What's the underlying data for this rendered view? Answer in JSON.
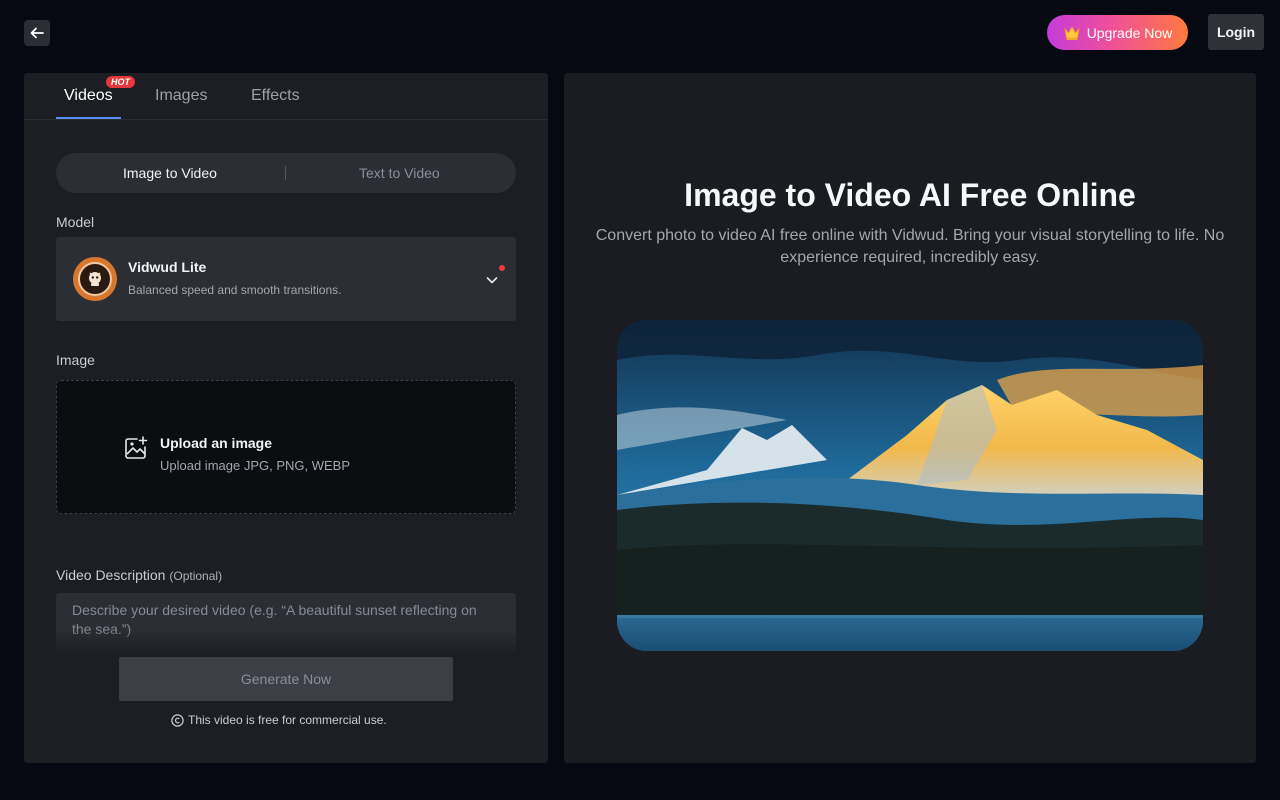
{
  "header": {
    "upgrade_label": "Upgrade Now",
    "login_label": "Login"
  },
  "tabs": [
    {
      "label": "Videos",
      "active": true,
      "badge": "HOT"
    },
    {
      "label": "Images",
      "active": false
    },
    {
      "label": "Effects",
      "active": false
    }
  ],
  "mode_switch": {
    "options": [
      "Image to Video",
      "Text to Video"
    ],
    "selected": "Image to Video"
  },
  "model": {
    "section_label": "Model",
    "name": "Vidwud Lite",
    "description": "Balanced speed and smooth transitions."
  },
  "image": {
    "section_label": "Image",
    "upload_title": "Upload an image",
    "upload_sub": "Upload image JPG, PNG, WEBP"
  },
  "video_description": {
    "label": "Video Description",
    "optional": "(Optional)",
    "placeholder": "Describe your desired video (e.g. “A beautiful sunset reflecting on the sea.”)"
  },
  "generate": {
    "label": "Generate Now",
    "license_note": "This video is free for commercial use."
  },
  "hero": {
    "title": "Image to Video AI Free Online",
    "subtitle": "Convert photo to video AI free online with Vidwud. Bring your visual storytelling to life. No experience required, incredibly easy."
  },
  "colors": {
    "accent": "#5b8df7",
    "hot_badge": "#e5363a",
    "upgrade_gradient": [
      "#c43bd9",
      "#ee4f9a",
      "#ff7a3d"
    ]
  },
  "icons": [
    "back-arrow-icon",
    "crown-icon",
    "chevron-down-icon",
    "image-plus-icon",
    "copyright-icon"
  ]
}
